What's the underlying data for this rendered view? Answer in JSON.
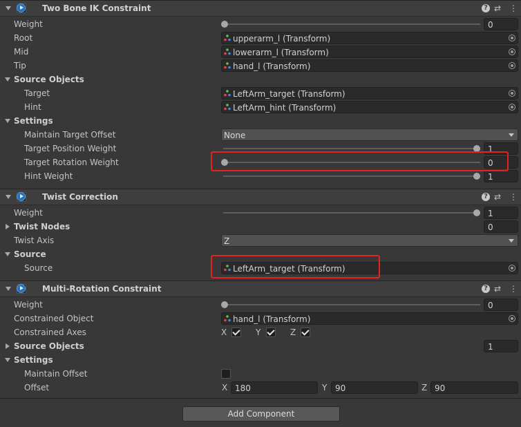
{
  "components": [
    {
      "title": "Two Bone IK Constraint",
      "weight_label": "Weight",
      "weight_value": "0",
      "root_label": "Root",
      "root_value": "upperarm_l (Transform)",
      "mid_label": "Mid",
      "mid_value": "lowerarm_l (Transform)",
      "tip_label": "Tip",
      "tip_value": "hand_l (Transform)",
      "source_objects_label": "Source Objects",
      "target_label": "Target",
      "target_value": "LeftArm_target (Transform)",
      "hint_label": "Hint",
      "hint_value": "LeftArm_hint (Transform)",
      "settings_label": "Settings",
      "maintain_target_offset_label": "Maintain Target Offset",
      "maintain_target_offset_value": "None",
      "target_position_weight_label": "Target Position Weight",
      "target_position_weight_value": "1",
      "target_rotation_weight_label": "Target Rotation Weight",
      "target_rotation_weight_value": "0",
      "hint_weight_label": "Hint Weight",
      "hint_weight_value": "1"
    },
    {
      "title": "Twist Correction",
      "weight_label": "Weight",
      "weight_value": "1",
      "twist_nodes_label": "Twist Nodes",
      "twist_nodes_count": "0",
      "twist_axis_label": "Twist Axis",
      "twist_axis_value": "Z",
      "source_group_label": "Source",
      "source_label": "Source",
      "source_value": "LeftArm_target (Transform)"
    },
    {
      "title": "Multi-Rotation Constraint",
      "weight_label": "Weight",
      "weight_value": "0",
      "constrained_object_label": "Constrained Object",
      "constrained_object_value": "hand_l (Transform)",
      "constrained_axes_label": "Constrained Axes",
      "axis_x": "X",
      "axis_y": "Y",
      "axis_z": "Z",
      "source_objects_label": "Source Objects",
      "source_objects_count": "1",
      "settings_label": "Settings",
      "maintain_offset_label": "Maintain Offset",
      "offset_label": "Offset",
      "offset_x": "180",
      "offset_y": "90",
      "offset_z": "90"
    }
  ],
  "header_icons": {
    "help": "?",
    "presets": "⇄",
    "menu": "⋮"
  },
  "add_component_label": "Add Component",
  "colors": {
    "highlight": "#e8231f",
    "component_icon": "#2b6fb4",
    "background": "#383838"
  }
}
